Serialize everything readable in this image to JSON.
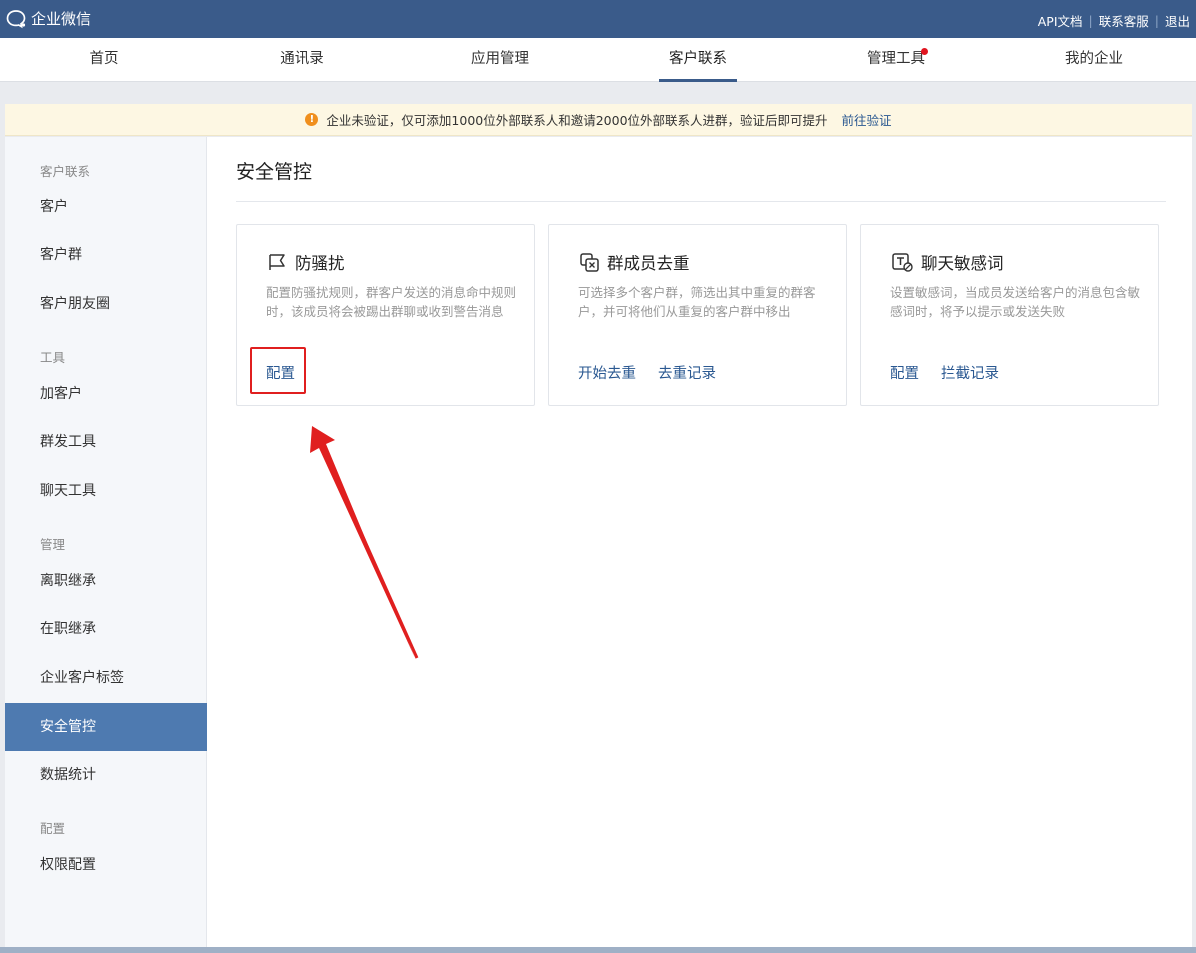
{
  "app": {
    "name": "企业微信"
  },
  "toplinks": [
    "API文档",
    "联系客服",
    "退出"
  ],
  "nav": {
    "items": [
      {
        "label": "首页"
      },
      {
        "label": "通讯录"
      },
      {
        "label": "应用管理"
      },
      {
        "label": "客户联系",
        "active": true
      },
      {
        "label": "管理工具",
        "badge": "dot"
      },
      {
        "label": "我的企业"
      }
    ]
  },
  "notice": {
    "text": "企业未验证，仅可添加1000位外部联系人和邀请2000位外部联系人进群，验证后即可提升",
    "link": "前往验证"
  },
  "sidebar": {
    "groups": [
      {
        "title": "客户联系",
        "items": [
          "客户",
          "客户群",
          "客户朋友圈"
        ]
      },
      {
        "title": "工具",
        "items": [
          "加客户",
          "群发工具",
          "聊天工具"
        ]
      },
      {
        "title": "管理",
        "items": [
          "离职继承",
          "在职继承",
          "企业客户标签",
          "安全管控",
          "数据统计"
        ]
      },
      {
        "title": "配置",
        "items": [
          "权限配置"
        ]
      }
    ],
    "active": "安全管控"
  },
  "main": {
    "title": "安全管控",
    "cards": [
      {
        "icon": "flag-icon",
        "title": "防骚扰",
        "desc": "配置防骚扰规则，群客户发送的消息命中规则时，该成员将会被踢出群聊或收到警告消息",
        "actions": [
          "配置"
        ]
      },
      {
        "icon": "dedup-icon",
        "title": "群成员去重",
        "desc": "可选择多个客户群，筛选出其中重复的群客户，并可将他们从重复的客户群中移出",
        "actions": [
          "开始去重",
          "去重记录"
        ]
      },
      {
        "icon": "sensitive-word-icon",
        "title": "聊天敏感词",
        "desc": "设置敏感词，当成员发送给客户的消息包含敏感词时，将予以提示或发送失败",
        "actions": [
          "配置",
          "拦截记录"
        ]
      }
    ]
  },
  "annotation": {
    "color": "#e01f1f"
  }
}
